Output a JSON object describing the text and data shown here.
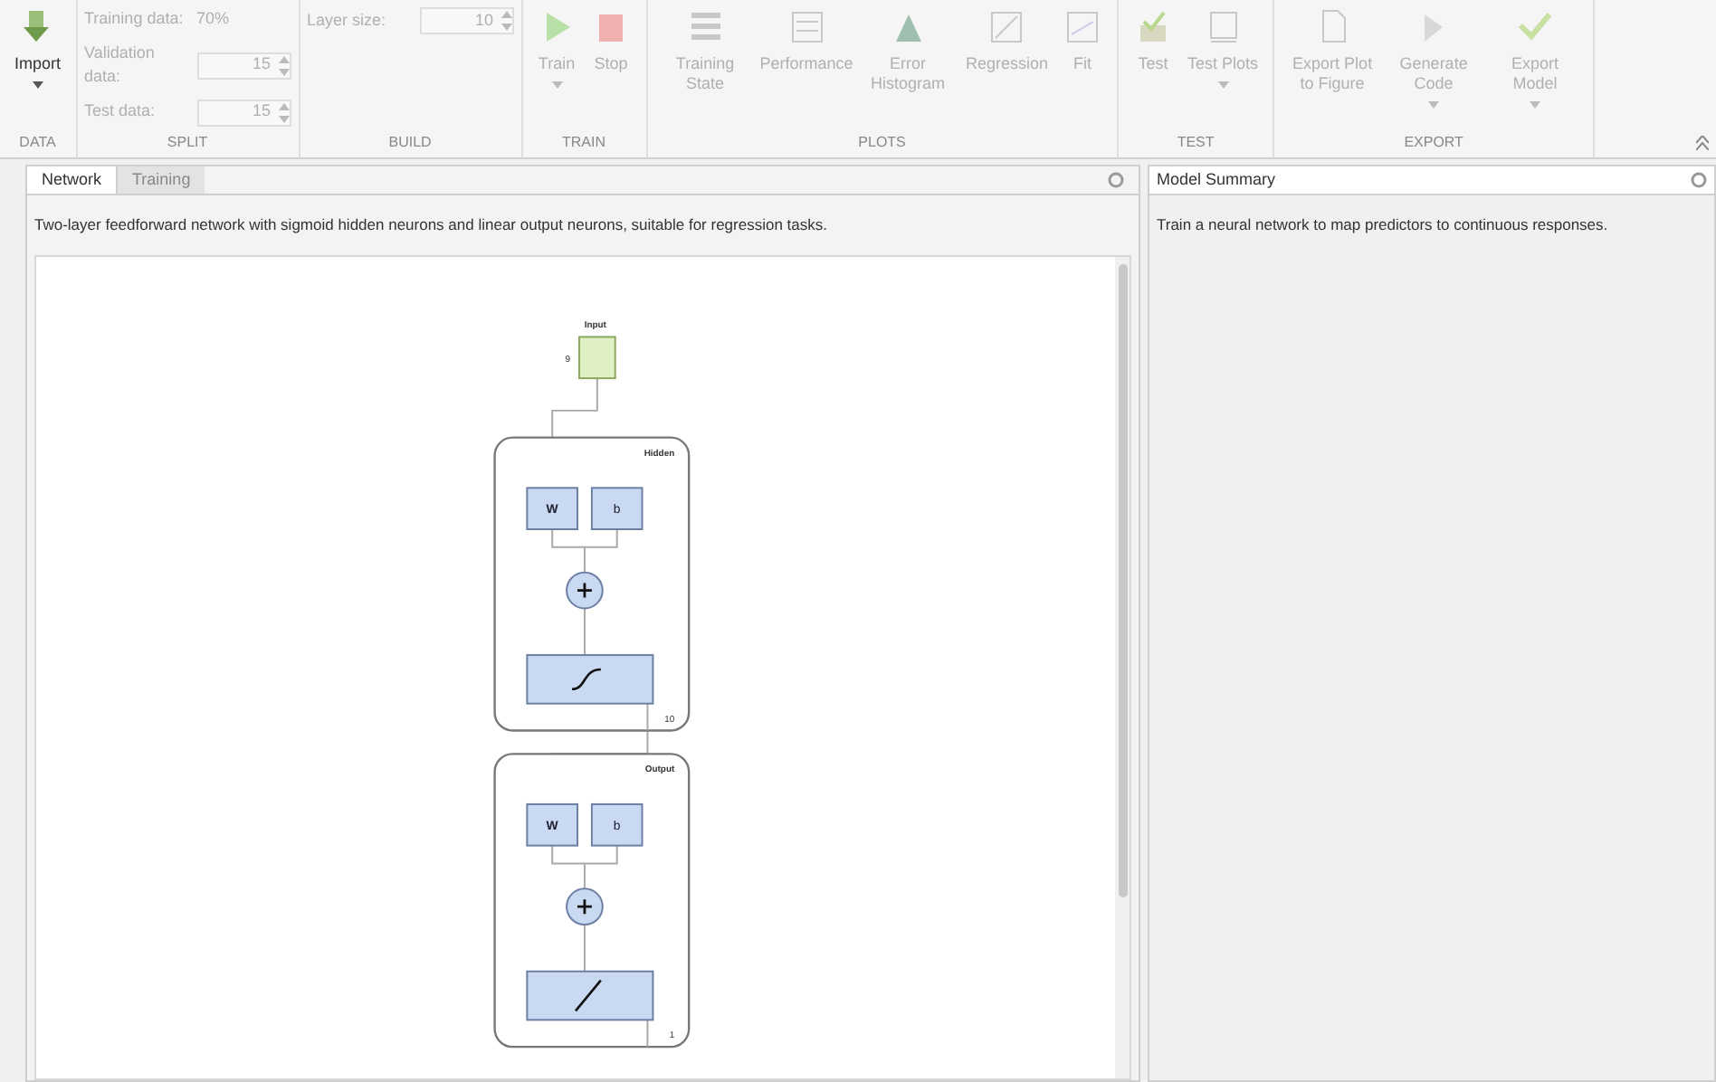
{
  "toolstrip": {
    "groups": [
      {
        "label": "DATA",
        "items": [
          {
            "kind": "button",
            "label": "Import",
            "dropdown": true,
            "disabled": false
          }
        ]
      },
      {
        "label": "SPLIT",
        "items": [
          {
            "kind": "text",
            "label": "Training data:",
            "value": "70%"
          },
          {
            "kind": "spinner",
            "label": "Validation data:",
            "value": "15",
            "disabled": true
          },
          {
            "kind": "spinner",
            "label": "Test data:",
            "value": "15",
            "disabled": true
          }
        ]
      },
      {
        "label": "BUILD",
        "items": [
          {
            "kind": "spinner",
            "label": "Layer size:",
            "value": "10",
            "disabled": true
          }
        ]
      },
      {
        "label": "TRAIN",
        "items": [
          {
            "kind": "button",
            "label": "Train",
            "dropdown": true,
            "disabled": true
          },
          {
            "kind": "button",
            "label": "Stop",
            "dropdown": false,
            "disabled": true
          }
        ]
      },
      {
        "label": "PLOTS",
        "items": [
          {
            "kind": "button",
            "label": "Training State",
            "dropdown": false,
            "disabled": true
          },
          {
            "kind": "button",
            "label": "Performance",
            "dropdown": false,
            "disabled": true
          },
          {
            "kind": "button",
            "label": "Error Histogram",
            "dropdown": false,
            "disabled": true
          },
          {
            "kind": "button",
            "label": "Regression",
            "dropdown": false,
            "disabled": true
          },
          {
            "kind": "button",
            "label": "Fit",
            "dropdown": false,
            "disabled": true
          }
        ]
      },
      {
        "label": "TEST",
        "items": [
          {
            "kind": "button",
            "label": "Test",
            "dropdown": false,
            "disabled": true
          },
          {
            "kind": "button",
            "label": "Test Plots",
            "dropdown": true,
            "disabled": true
          }
        ]
      },
      {
        "label": "EXPORT",
        "items": [
          {
            "kind": "button",
            "label": "Export Plot to Figure",
            "dropdown": false,
            "disabled": true
          },
          {
            "kind": "button",
            "label": "Generate Code",
            "dropdown": true,
            "disabled": true
          },
          {
            "kind": "button",
            "label": "Export Model",
            "dropdown": true,
            "disabled": true
          }
        ]
      }
    ]
  },
  "network_panel": {
    "tabs": [
      {
        "label": "Network",
        "selected": true
      },
      {
        "label": "Training",
        "selected": false
      }
    ],
    "description": "Two-layer feedforward network with sigmoid hidden neurons and linear output neurons, suitable for regression tasks.",
    "diagram": {
      "input": {
        "label": "Input",
        "size": "9"
      },
      "layers": [
        {
          "title": "Hidden",
          "weight": "W",
          "bias": "b",
          "kind": "sigmoid",
          "size": "10"
        },
        {
          "title": "Output",
          "weight": "W",
          "bias": "b",
          "kind": "linear",
          "size": "1"
        }
      ]
    }
  },
  "summary_panel": {
    "title": "Model Summary",
    "text": "Train a neural network to map predictors to continuous responses."
  }
}
